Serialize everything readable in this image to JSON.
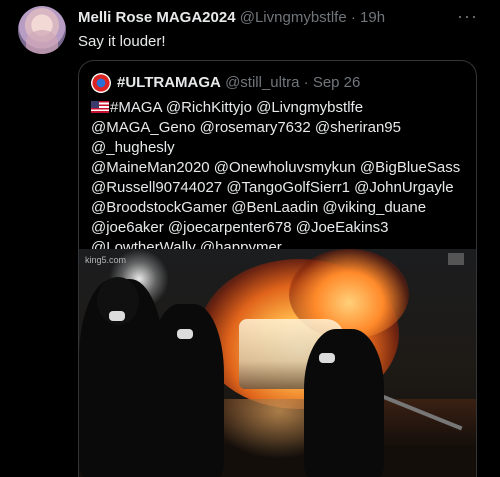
{
  "tweet": {
    "display_name": "Melli Rose MAGA2024",
    "handle": "@Livngmybstlfe",
    "separator": "·",
    "time": "19h",
    "text": "Say it louder!",
    "more": "···"
  },
  "quoted": {
    "display_name": "#ULTRAMAGA",
    "handle": "@still_ultra",
    "separator": "·",
    "date": "Sep 26",
    "text_lines": [
      "#MAGA @RichKittyjo @Livngmybstlfe",
      "@MAGA_Geno @rosemary7632 @sheriran95 @_hughesly",
      "@MaineMan2020 @Onewholuvsmykun @BigBlueSass",
      "@Russell90744027 @TangoGolfSierr1 @JohnUrgayle",
      "@BroodstockGamer @BenLaadin @viking_duane",
      "@joe6aker @joecarpenter678 @JoeEakins3",
      "@LowtherWally @happymer"
    ],
    "media_watermark": "king5.com"
  }
}
